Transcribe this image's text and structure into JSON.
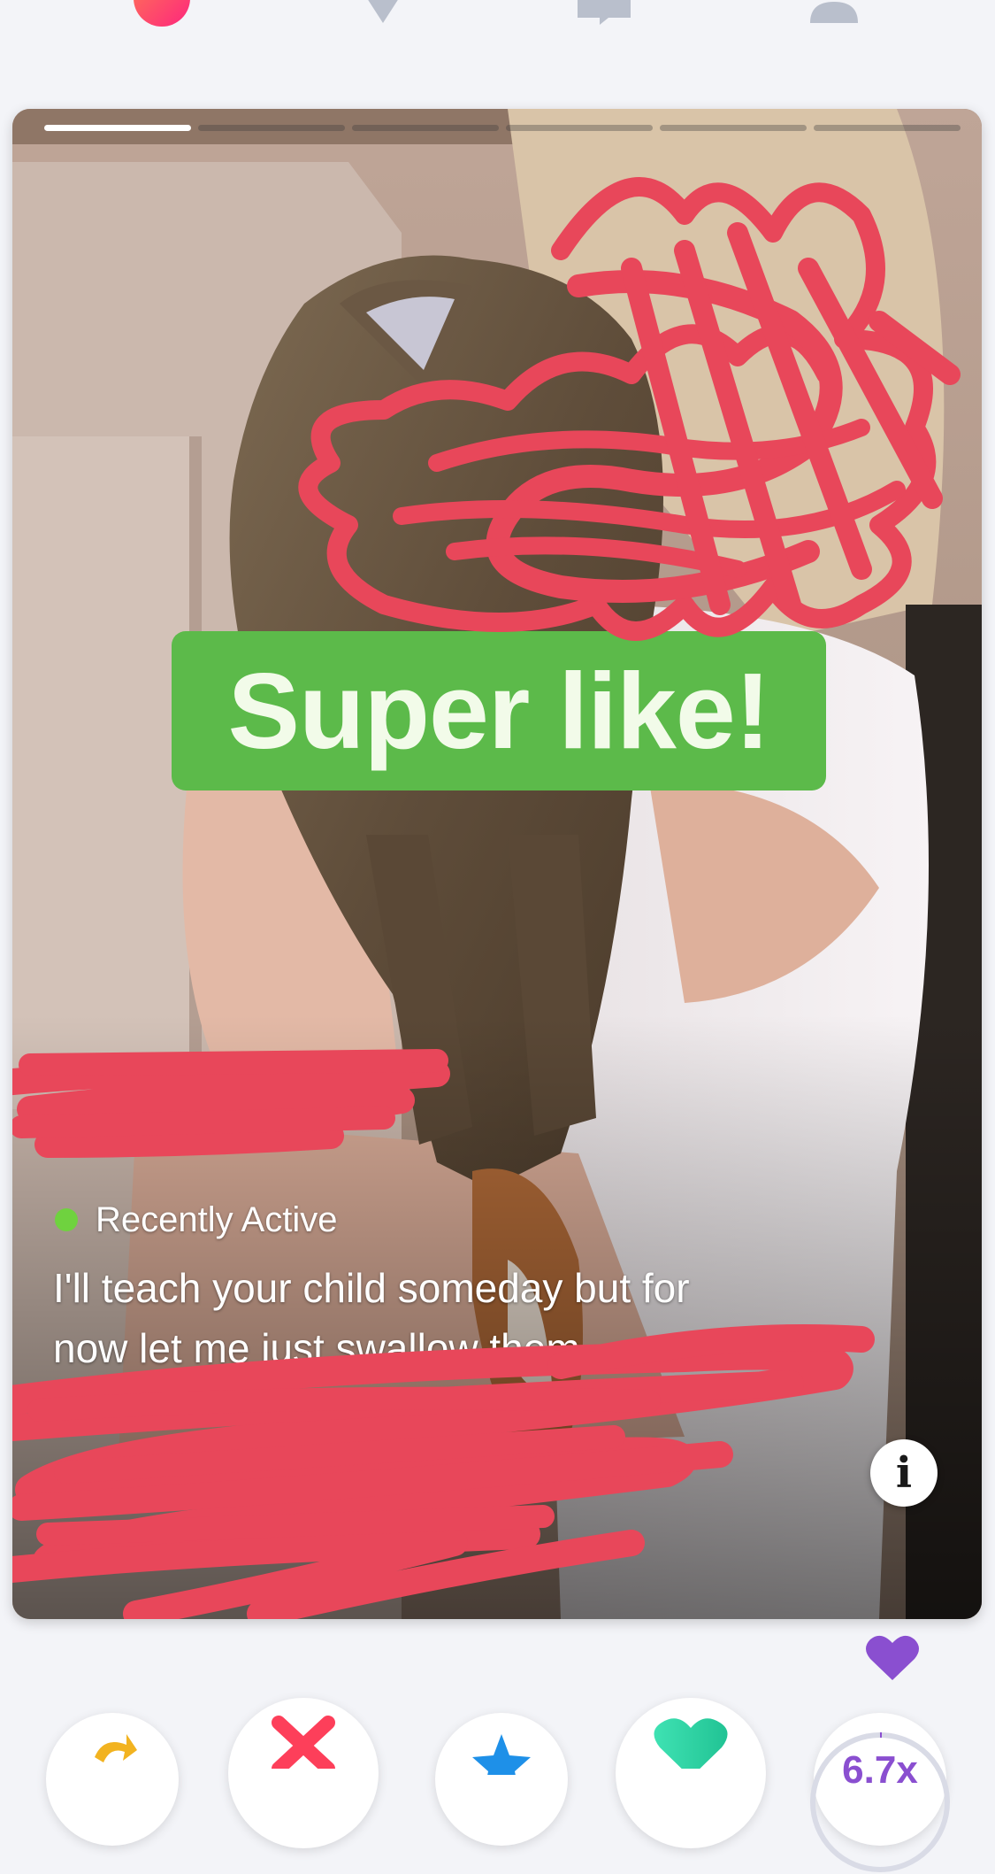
{
  "nav": {
    "icons": [
      "flame-icon",
      "diamond-icon",
      "chat-icon",
      "profile-icon"
    ]
  },
  "card": {
    "photo_count": 6,
    "active_photo": 1,
    "stamp_text": "Super like!",
    "status": "Recently Active",
    "bio_lines": [
      "I'll teach your child someday but for",
      "now let me just swallow them."
    ],
    "info_label": "i"
  },
  "actions": {
    "rewind": "rewind-icon",
    "nope": "close-icon",
    "superlike": "star-icon",
    "like": "heart-icon",
    "boost_label": "6.7x"
  },
  "colors": {
    "superlike_green": "#5cba4a",
    "active_green": "#6fd23f",
    "scribble_red": "#e8475a",
    "boost_purple": "#8a4fd0"
  }
}
